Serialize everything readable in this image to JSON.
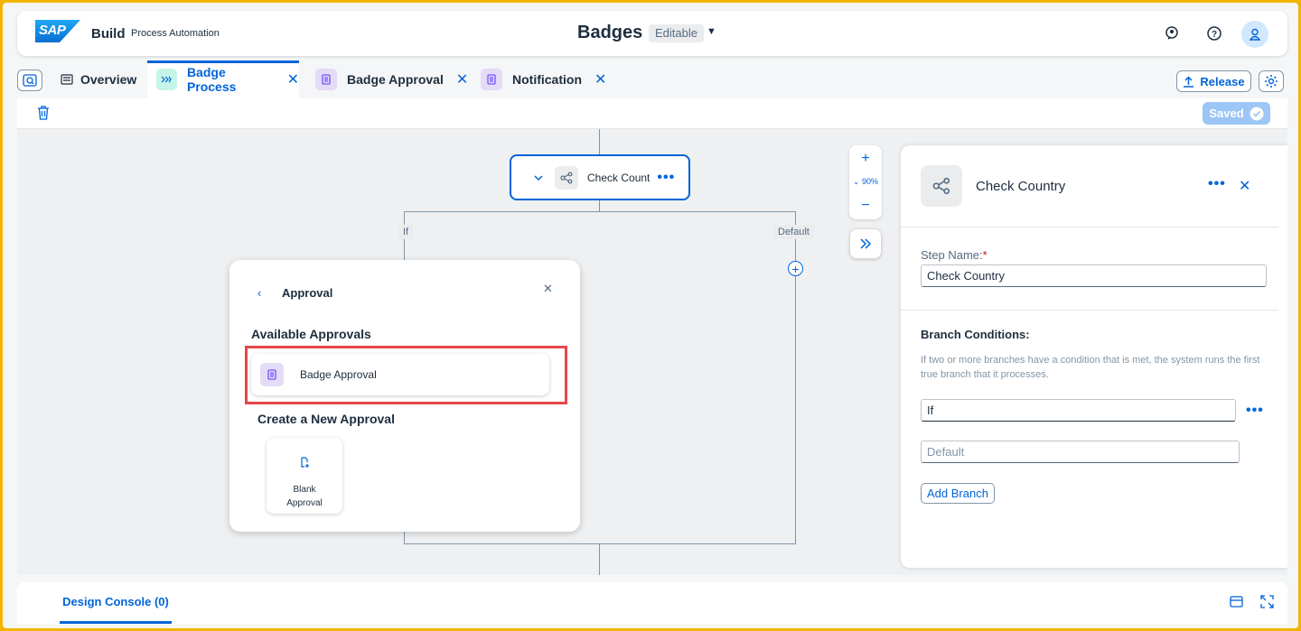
{
  "shell": {
    "logo": "SAP",
    "product": "Build",
    "product_sub": "Process Automation",
    "title": "Badges",
    "status": "Editable"
  },
  "tabs": [
    {
      "label": "Overview",
      "icon": "overview-icon"
    },
    {
      "label": "Badge Process",
      "icon": "process-icon",
      "active": true
    },
    {
      "label": "Badge Approval",
      "icon": "form-icon"
    },
    {
      "label": "Notification",
      "icon": "form-icon"
    }
  ],
  "toolbar": {
    "release_label": "Release",
    "saved_label": "Saved"
  },
  "canvas": {
    "node_label": "Check Count",
    "branch_if": "If",
    "branch_default": "Default",
    "zoom_level": "90%"
  },
  "popover": {
    "title": "Approval",
    "available_heading": "Available Approvals",
    "approval_item": "Badge Approval",
    "create_heading": "Create a New Approval",
    "blank_label_line1": "Blank",
    "blank_label_line2": "Approval"
  },
  "properties": {
    "title": "Check Country",
    "step_name_label": "Step Name:",
    "step_name_value": "Check Country",
    "branch_conditions_label": "Branch Conditions:",
    "help_text": "If two or more branches have a condition that is met, the system runs the first true branch that it processes.",
    "branch_if_value": "If",
    "branch_default_placeholder": "Default",
    "add_branch_label": "Add Branch"
  },
  "console": {
    "tab_label": "Design Console (0)"
  },
  "colors": {
    "accent": "#0064d9",
    "highlight": "#e5474b",
    "frame": "#f2b400"
  }
}
